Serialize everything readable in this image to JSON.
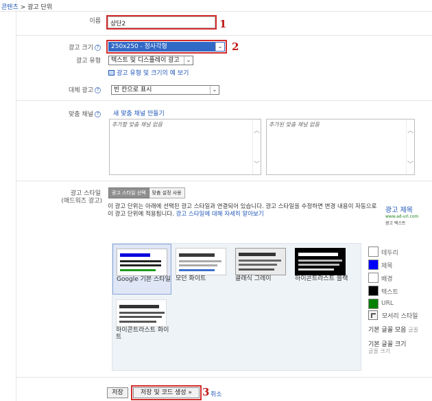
{
  "breadcrumb": {
    "root": "콘텐츠",
    "separator": ">",
    "current": "광고 단위"
  },
  "form": {
    "name_label": "이름",
    "name_value": "상단2",
    "size_label": "광고 크기",
    "size_value": "250x250 - 정사각형",
    "type_label": "광고 유형",
    "type_value": "텍스트 및 디스플레이 광고",
    "type_example_link": "광고 유형 및 크기의 예 보기",
    "fallback_label": "대체 광고",
    "fallback_value": "빈 칸으로 표시",
    "channel_label": "맞춤 채널",
    "new_channel_link": "새 맞춤 채널 만들기",
    "channel_available_empty": "추가할 맞춤 채널 없음",
    "channel_added_empty": "추가된 맞춤 채널 없음"
  },
  "style": {
    "label": "광고 스타일",
    "sublabel": "(애드워즈 광고)",
    "tab_select": "광고 스타일 선택",
    "tab_custom": "맞춤 설정 사용",
    "description": "이 광고 단위는 아래에 선택된 광고 스타일과 연결되어 있습니다. 광고 스타일을 수정하면 변경 내용이 자동으로 이 광고 단위에 적용됩니다.",
    "learn_more_link": "광고 스타일에 대해 자세히 알아보기",
    "preview": {
      "title": "광고 제목",
      "url": "www.ad-url.com",
      "text": "광고 텍스트"
    },
    "tiles": [
      {
        "name": "Google 기본 스타일"
      },
      {
        "name": "모던 화이트"
      },
      {
        "name": "클래식 그레이"
      },
      {
        "name": "하이콘트라스트 블랙"
      },
      {
        "name": "하이콘트라스트 화이트"
      }
    ],
    "swatches": [
      {
        "label": "테두리",
        "color": "#ffffff"
      },
      {
        "label": "제목",
        "color": "#0000ff"
      },
      {
        "label": "배경",
        "color": "#ffffff"
      },
      {
        "label": "텍스트",
        "color": "#000000"
      },
      {
        "label": "URL",
        "color": "#008000"
      }
    ],
    "corner_label": "모서리 스타일",
    "font_family_label": "기본 글꼴 모음",
    "font_family_value": "글꼴",
    "font_size_label": "기본 글꼴 크기",
    "font_size_value": "글꼴 크기"
  },
  "actions": {
    "save": "저장",
    "save_code": "저장 및 코드 생성 »",
    "cancel": "취소"
  },
  "annotations": [
    "1",
    "2",
    "3"
  ],
  "colors": {
    "link": "#1f56b8",
    "highlight_red": "#d22b2b",
    "selection_blue": "#3169c6"
  }
}
